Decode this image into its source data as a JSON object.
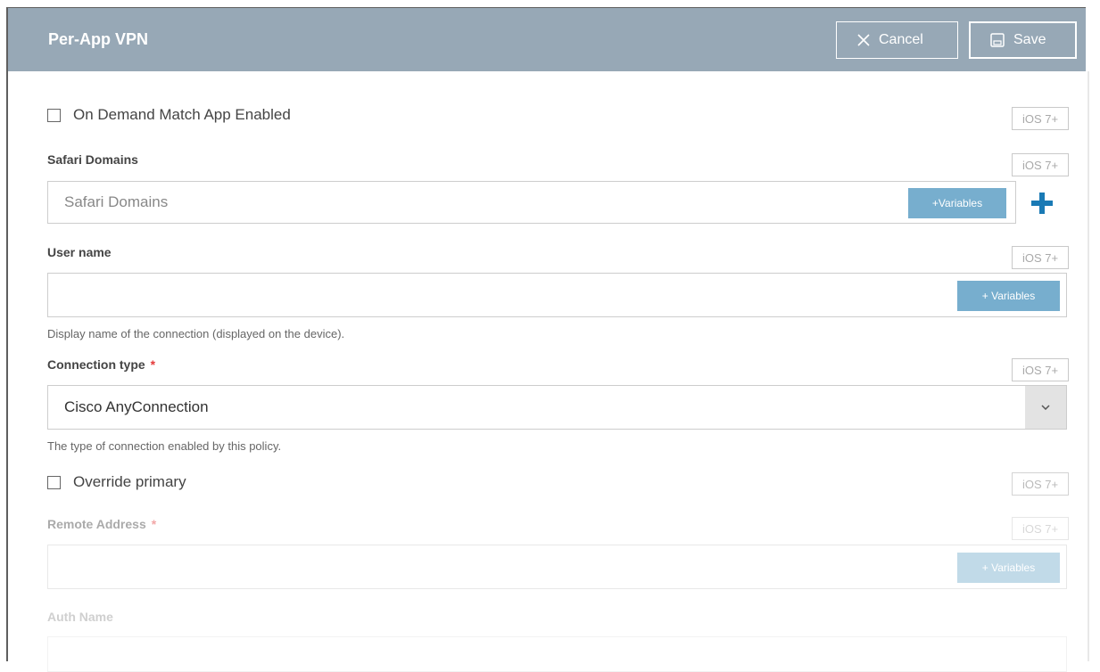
{
  "header": {
    "title": "Per-App VPN",
    "cancel_label": "Cancel",
    "save_label": "Save",
    "bg_color": "#97a8b6"
  },
  "form": {
    "on_demand": {
      "label": "On Demand Match App Enabled",
      "checked": false,
      "badge": "iOS 7+"
    },
    "safari_domains": {
      "label": "Safari Domains",
      "placeholder": "Safari Domains",
      "variables": "+Variables",
      "badge": "iOS 7+"
    },
    "user_name": {
      "label": "User name",
      "value": "",
      "variables": "+ Variables",
      "badge": "iOS 7+",
      "hint": "Display name of the connection (displayed on the device)."
    },
    "connection_type": {
      "label": "Connection type",
      "required": "*",
      "value": "Cisco AnyConnection",
      "badge": "iOS 7+",
      "hint": "The type of connection enabled by this policy."
    },
    "override_primary": {
      "label": "Override primary",
      "checked": false,
      "badge": "iOS 7+"
    },
    "remote_address": {
      "label": "Remote Address",
      "required": "*",
      "value": "",
      "variables": "+ Variables",
      "badge": "iOS 7+"
    },
    "auth_name": {
      "label": "Auth Name"
    }
  },
  "colors": {
    "accent": "#1a7ab5",
    "variables_button": "#77aece",
    "required": "#e43b3b"
  }
}
